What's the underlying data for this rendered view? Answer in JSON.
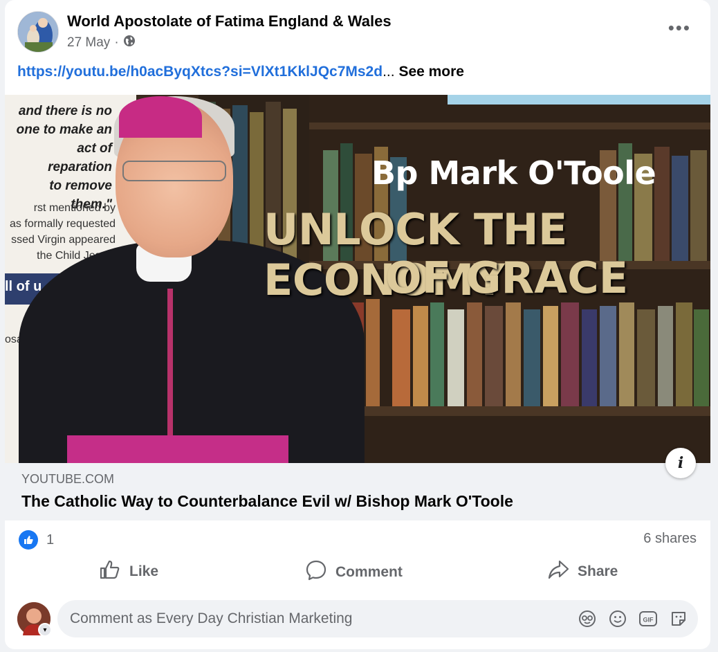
{
  "post": {
    "page_name": "World Apostolate of Fatima England & Wales",
    "date": "27 May",
    "separator": "·",
    "privacy_icon": "globe-icon",
    "more_icon": "ellipsis-icon",
    "text_link": "https://youtu.be/h0acByqXtcs?si=VlXt1KklJQc7Ms2d",
    "text_ellipsis": "...",
    "see_more": "See more"
  },
  "media": {
    "poster_top": [
      "and there is no",
      "one to make an",
      "act of reparation",
      "to remove them.\""
    ],
    "poster_mid": [
      "rst mentioned by",
      "as formally requested",
      "ssed Virgin appeared",
      "the Child Jesus."
    ],
    "poster_bar": "ll of u",
    "poster_tag": "osa",
    "title_1": "Bp Mark O'Toole",
    "title_2": "UNLOCK THE ECONOMY",
    "title_3": "OF GRACE",
    "info_icon": "i"
  },
  "link_preview": {
    "domain": "YOUTUBE.COM",
    "title": "The Catholic Way to Counterbalance Evil w/ Bishop Mark O'Toole"
  },
  "stats": {
    "reaction_count": "1",
    "shares": "6 shares"
  },
  "actions": {
    "like": "Like",
    "comment": "Comment",
    "share": "Share"
  },
  "comment_box": {
    "placeholder": "Comment as Every Day Christian Marketing",
    "icons": [
      "avatar-sticker-icon",
      "emoji-icon",
      "gif-icon",
      "sticker-icon"
    ]
  },
  "colors": {
    "link": "#216fdb",
    "like_blue": "#1877f2",
    "muted_text": "#65676b",
    "preview_bg": "#f0f2f5"
  }
}
